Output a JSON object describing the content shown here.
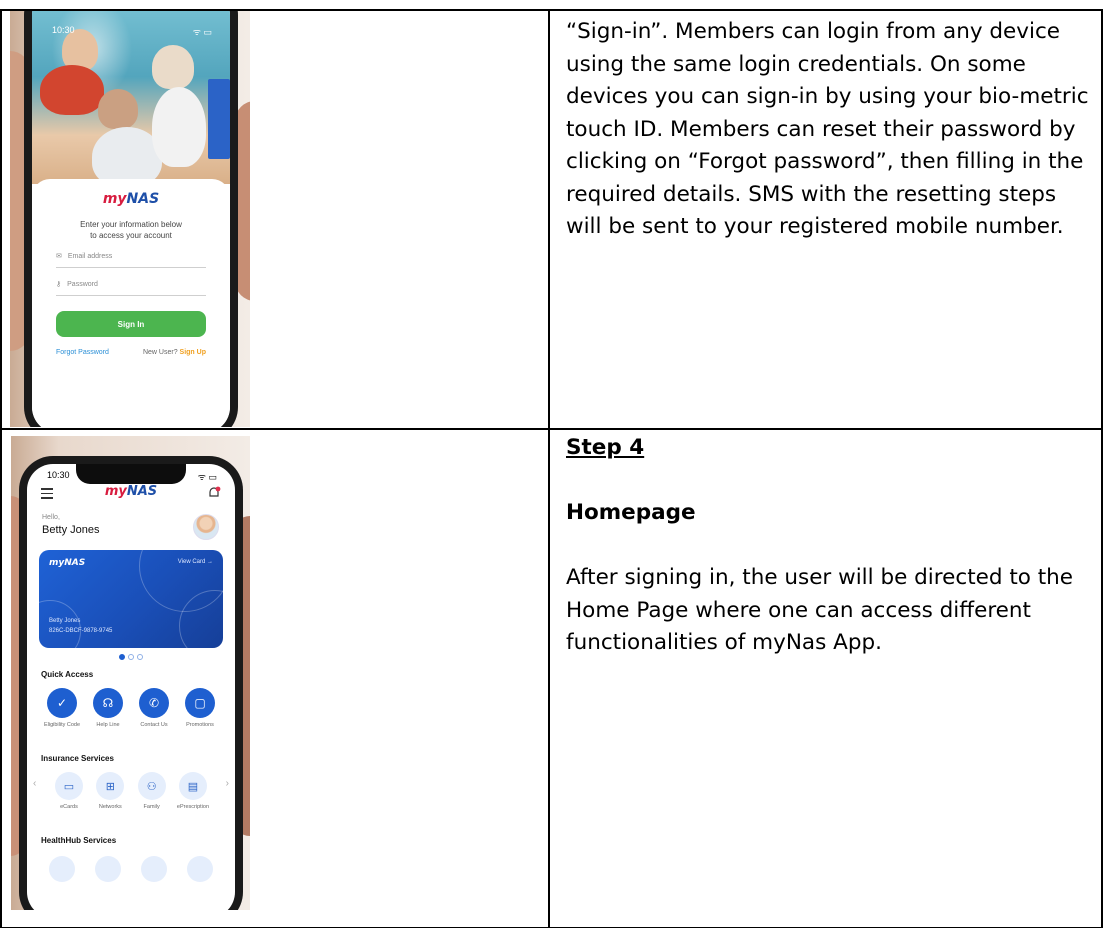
{
  "row1": {
    "paragraph": "“Sign-in”. Members can login from any device using the same login credentials. On some devices you can sign-in by using your bio-metric touch ID. Members can reset their password by clicking on “Forgot password”, then filling in the required details. SMS with the resetting steps will be sent to your registered mobile number.",
    "phone": {
      "time": "10:30",
      "status_icons": "ᯤ ▭",
      "logo_my": "my",
      "logo_nas": "NAS",
      "prompt_line1": "Enter your information below",
      "prompt_line2": "to access your account",
      "email_placeholder": "Email address",
      "password_placeholder": "Password",
      "email_icon": "✉",
      "password_icon": "⚷",
      "signin_label": "Sign In",
      "forgot_label": "Forgot Password",
      "new_user_label": "New User?",
      "signup_label": "Sign Up"
    }
  },
  "row2": {
    "step": "Step 4",
    "section": "Homepage",
    "paragraph": "After signing in, the user will be directed to the Home Page where one can access different functionalities of myNas App.",
    "phone": {
      "time": "10:30",
      "status_icons": "ᯤ ▭",
      "logo_my": "my",
      "logo_nas": "NAS",
      "hello": "Hello,",
      "user_name": "Betty Jones",
      "card_logo": "myNAS",
      "view_card": "View Card →",
      "card_name": "Betty Jones",
      "card_number": "826C-DBCF-9878-9745",
      "quick_access_title": "Quick Access",
      "quick_access": [
        {
          "label": "Eligibility Code",
          "icon": "check-icon",
          "glyph": "✓"
        },
        {
          "label": "Help Line",
          "icon": "headset-icon",
          "glyph": "☊"
        },
        {
          "label": "Contact Us",
          "icon": "phone-icon",
          "glyph": "✆"
        },
        {
          "label": "Promotions",
          "icon": "bag-icon",
          "glyph": "▢"
        }
      ],
      "insurance_title": "Insurance Services",
      "insurance": [
        {
          "label": "eCards",
          "icon": "card-icon",
          "glyph": "▭"
        },
        {
          "label": "Networks",
          "icon": "hospital-icon",
          "glyph": "⊞"
        },
        {
          "label": "Family",
          "icon": "family-icon",
          "glyph": "⚇"
        },
        {
          "label": "ePrescription",
          "icon": "prescription-icon",
          "glyph": "▤"
        }
      ],
      "healthhub_title": "HealthHub Services"
    }
  },
  "colors": {
    "brand_red": "#d81c3f",
    "brand_blue": "#1e4fa8",
    "signin_green": "#4cb54f",
    "accent_blue": "#1e5fd0",
    "signup_orange": "#f0a020"
  }
}
